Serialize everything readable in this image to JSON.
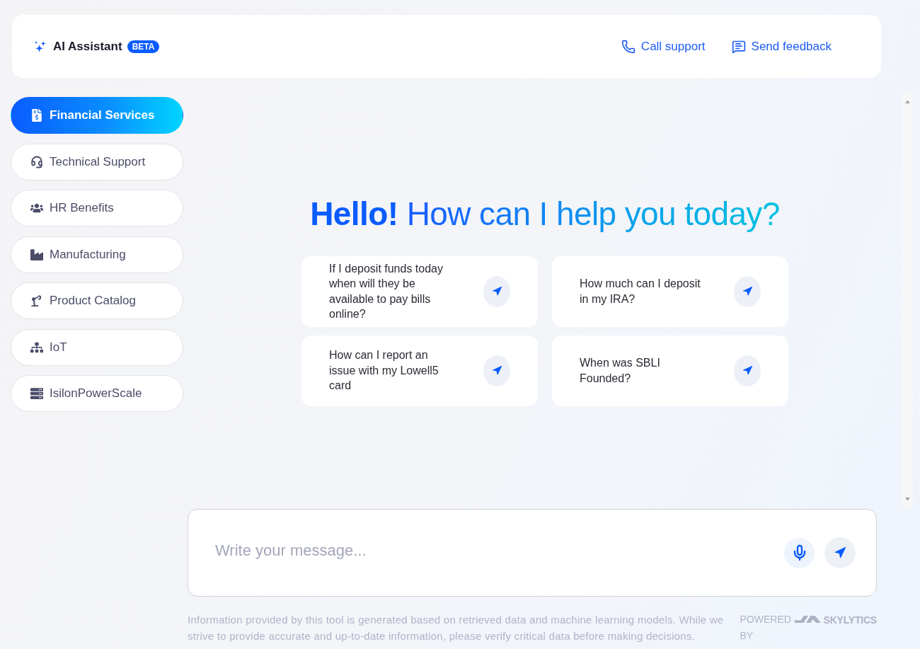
{
  "header": {
    "title": "AI Assistant",
    "badge": "BETA",
    "links": [
      {
        "label": "Call support"
      },
      {
        "label": "Send feedback"
      }
    ]
  },
  "sidebar": {
    "items": [
      {
        "label": "Financial Services",
        "selected": true
      },
      {
        "label": "Technical Support",
        "selected": false
      },
      {
        "label": "HR Benefits",
        "selected": false
      },
      {
        "label": "Manufacturing",
        "selected": false
      },
      {
        "label": "Product Catalog",
        "selected": false
      },
      {
        "label": "IoT",
        "selected": false
      },
      {
        "label": "IsilonPowerScale",
        "selected": false
      }
    ]
  },
  "greeting": {
    "emphasis": "Hello!",
    "text": "How can I help you today?"
  },
  "suggestions": [
    {
      "text": "If I deposit funds today when will they be available to pay bills online?"
    },
    {
      "text": "How much can I deposit in my IRA?"
    },
    {
      "text": "How can I report an issue with my Lowell5 card"
    },
    {
      "text": "When was SBLI Founded?"
    }
  ],
  "composer": {
    "placeholder": "Write your message..."
  },
  "footer": {
    "disclaimer": "Information provided by this tool is generated based on retrieved data and machine learning models. While we strive to provide accurate and up-to-date information, please verify critical data before making decisions.",
    "powered_by": "POWERED BY",
    "brand": "SKYLYTICS"
  }
}
